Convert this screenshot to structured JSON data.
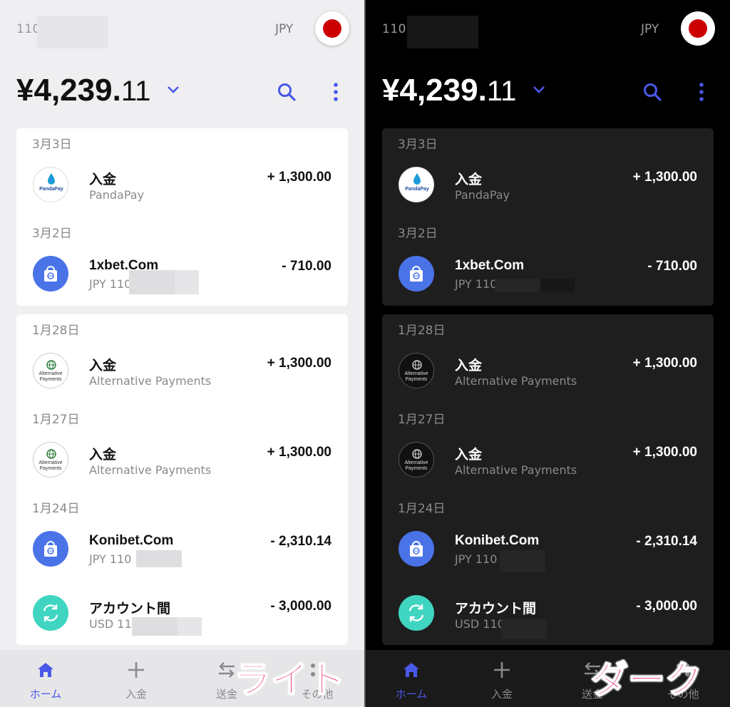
{
  "theme_colors": {
    "accent": "#4a58e8",
    "light_bg": "#efeff1",
    "dark_bg": "#000000",
    "overlay_label": "#e8196f"
  },
  "header": {
    "account_prefix_light": "110",
    "account_prefix_dark": "110",
    "currency": "JPY",
    "balance_main": "¥4,239.",
    "balance_decimals": "11"
  },
  "icons": {
    "dropdown": "chevron-down-icon",
    "search": "search-icon",
    "more": "more-vertical-icon"
  },
  "group1": {
    "date1": "3月3日",
    "tx1": {
      "title": "入金",
      "subtitle": "PandaPay",
      "amount": "+ 1,300.00",
      "logo_text": "PandaPay"
    },
    "date2": "3月2日",
    "tx2": {
      "title": "1xbet.Com",
      "subtitle_light": "JPY 110",
      "subtitle_dark": "JPY 110",
      "amount": "- 710.00"
    }
  },
  "group2": {
    "date1": "1月28日",
    "tx1": {
      "title": "入金",
      "subtitle": "Alternative Payments",
      "amount": "+ 1,300.00",
      "logo_text": "Alternative Payments"
    },
    "date2": "1月27日",
    "tx2": {
      "title": "入金",
      "subtitle": "Alternative Payments",
      "amount": "+ 1,300.00",
      "logo_text": "Alternative Payments"
    },
    "date3": "1月24日",
    "tx3": {
      "title": "Konibet.Com",
      "subtitle_light": "JPY 110",
      "subtitle_dark": "JPY 110",
      "amount": "- 2,310.14"
    },
    "tx4": {
      "title": "アカウント間",
      "subtitle_light": "USD 110",
      "subtitle_dark": "USD 110",
      "amount": "- 3,000.00"
    }
  },
  "nav": {
    "home": "ホーム",
    "deposit": "入金",
    "send": "送金",
    "other": "その他"
  },
  "overlay": {
    "light": "ライト",
    "dark": "ダーク"
  }
}
